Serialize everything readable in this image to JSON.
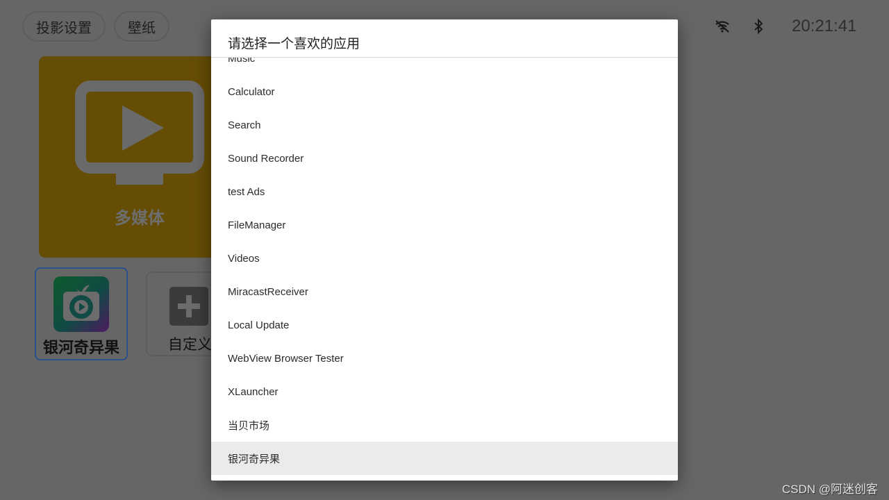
{
  "top_bar": {
    "buttons": [
      {
        "label": "投影设置"
      },
      {
        "label": "壁纸"
      }
    ],
    "status_icons": [
      "wifi-off-icon",
      "bluetooth-icon"
    ],
    "clock": "20:21:41"
  },
  "home": {
    "media_tile": {
      "label": "多媒体",
      "icon": "tv-play-icon",
      "color": "#664d06"
    },
    "app_tile": {
      "label": "银河奇异果",
      "icon": "galaxy-fruit-app-icon"
    },
    "custom_tile": {
      "label": "自定义",
      "icon": "plus-icon"
    }
  },
  "dialog": {
    "title": "请选择一个喜欢的应用",
    "items": [
      {
        "label": "Music"
      },
      {
        "label": "Calculator"
      },
      {
        "label": "Search"
      },
      {
        "label": "Sound Recorder"
      },
      {
        "label": "test Ads"
      },
      {
        "label": "FileManager"
      },
      {
        "label": "Videos"
      },
      {
        "label": "MiracastReceiver"
      },
      {
        "label": "Local Update"
      },
      {
        "label": "WebView Browser Tester"
      },
      {
        "label": "XLauncher"
      },
      {
        "label": "当贝市场"
      },
      {
        "label": "银河奇异果",
        "selected": true
      }
    ]
  },
  "watermark": "CSDN @阿迷创客"
}
